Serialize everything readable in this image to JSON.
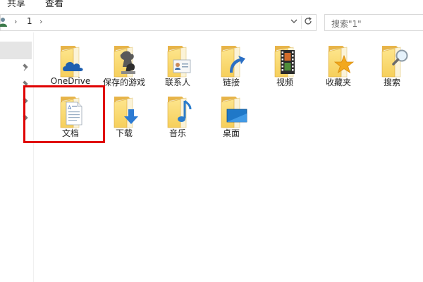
{
  "ribbon": {
    "tabs": [
      "共享",
      "查看"
    ]
  },
  "address": {
    "crumb": "1"
  },
  "search": {
    "placeholder": "搜索\"1\""
  },
  "items": [
    {
      "label": "OneDrive",
      "icon": "onedrive-folder-icon"
    },
    {
      "label": "保存的游戏",
      "icon": "saved-games-folder-icon"
    },
    {
      "label": "联系人",
      "icon": "contacts-folder-icon"
    },
    {
      "label": "链接",
      "icon": "links-folder-icon"
    },
    {
      "label": "视频",
      "icon": "videos-folder-icon"
    },
    {
      "label": "收藏夹",
      "icon": "favorites-folder-icon"
    },
    {
      "label": "搜索",
      "icon": "searches-folder-icon"
    },
    {
      "label": "文档",
      "icon": "documents-folder-icon"
    },
    {
      "label": "下载",
      "icon": "downloads-folder-icon"
    },
    {
      "label": "音乐",
      "icon": "music-folder-icon"
    },
    {
      "label": "桌面",
      "icon": "desktop-folder-icon"
    }
  ],
  "highlight": {
    "color": "#e00000",
    "target": "文档"
  }
}
